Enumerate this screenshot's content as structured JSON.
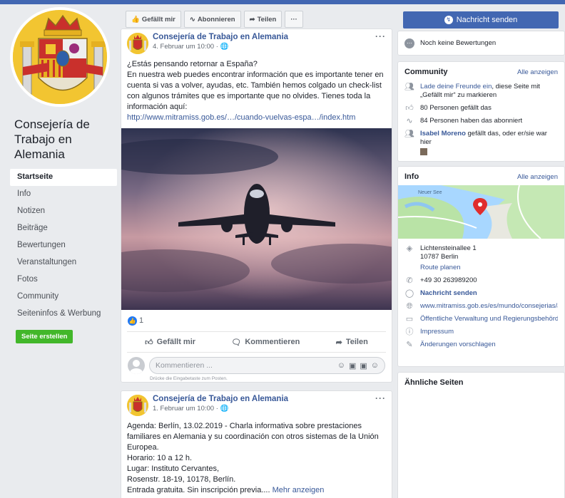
{
  "page": {
    "name": "Consejería de Trabajo en Alemania",
    "nav": [
      "Startseite",
      "Info",
      "Notizen",
      "Beiträge",
      "Bewertungen",
      "Veranstaltungen",
      "Fotos",
      "Community",
      "Seiteninfos & Werbung"
    ],
    "create_page": "Seite erstellen"
  },
  "actions": {
    "like": "Gefällt mir",
    "follow": "Abonnieren",
    "share": "Teilen",
    "more": "···",
    "message": "Nachricht senden"
  },
  "post1": {
    "author": "Consejería de Trabajo en Alemania",
    "date": "4. Februar um 10:00 ·",
    "text_lines": [
      "¿Estás pensando retornar a España?",
      "En nuestra web puedes encontrar información que es importante tener en",
      "cuenta si vas a volver, ayudas, etc. También hemos colgado un check-list",
      "con algunos trámites que es importante que no olvides. Tienes toda la",
      "información aquí:"
    ],
    "link": "http://www.mitramiss.gob.es/…/cuando-vuelvas-espa…/index.htm",
    "reaction_count": "1",
    "btn_like": "Gefällt mir",
    "btn_comment": "Kommentieren",
    "btn_share": "Teilen",
    "comment_placeholder": "Kommentieren ...",
    "comment_hint": "Drücke die Eingabetaste zum Posten."
  },
  "post2": {
    "author": "Consejería de Trabajo en Alemania",
    "date": "1. Februar um 10:00 ·",
    "text_lines": [
      "Agenda: Berlín, 13.02.2019 - Charla informativa sobre prestaciones",
      "familiares en Alemania y su coordinación con otros sistemas de la Unión",
      "Europea.",
      "Horario: 10 a 12 h.",
      "Lugar: Instituto Cervantes,",
      "Rosenstr. 18-19, 10178, Berlín."
    ],
    "last_line": "Entrada gratuita. Sin inscripción previa....",
    "more": "Mehr anzeigen"
  },
  "rating": {
    "text": "Noch keine Bewertungen"
  },
  "community": {
    "title": "Community",
    "see_all": "Alle anzeigen",
    "invite_link": "Lade deine Freunde ein",
    "invite_rest": ", diese Seite mit „Gefällt mir“ zu markieren",
    "likes": "80 Personen gefällt das",
    "follows": "84 Personen haben das abonniert",
    "friend_name": "Isabel Moreno",
    "friend_rest": " gefällt das, oder er/sie war hier"
  },
  "info": {
    "title": "Info",
    "see_all": "Alle anzeigen",
    "map_label": "Neuer See",
    "street": "Lichtensteinallee 1",
    "city": "10787 Berlin",
    "route": "Route planen",
    "phone": "+49 30 263989200",
    "message": "Nachricht senden",
    "website": "www.mitramiss.gob.es/es/mundo/consejerias/ale",
    "category": "Öffentliche Verwaltung und Regierungsbehörde",
    "impressum": "Impressum",
    "suggest": "Änderungen vorschlagen"
  },
  "similar": {
    "title": "Ähnliche Seiten"
  },
  "colors": {
    "brand": "#4267b2",
    "link": "#385898",
    "green": "#42b72a",
    "background": "#e9ebee"
  }
}
